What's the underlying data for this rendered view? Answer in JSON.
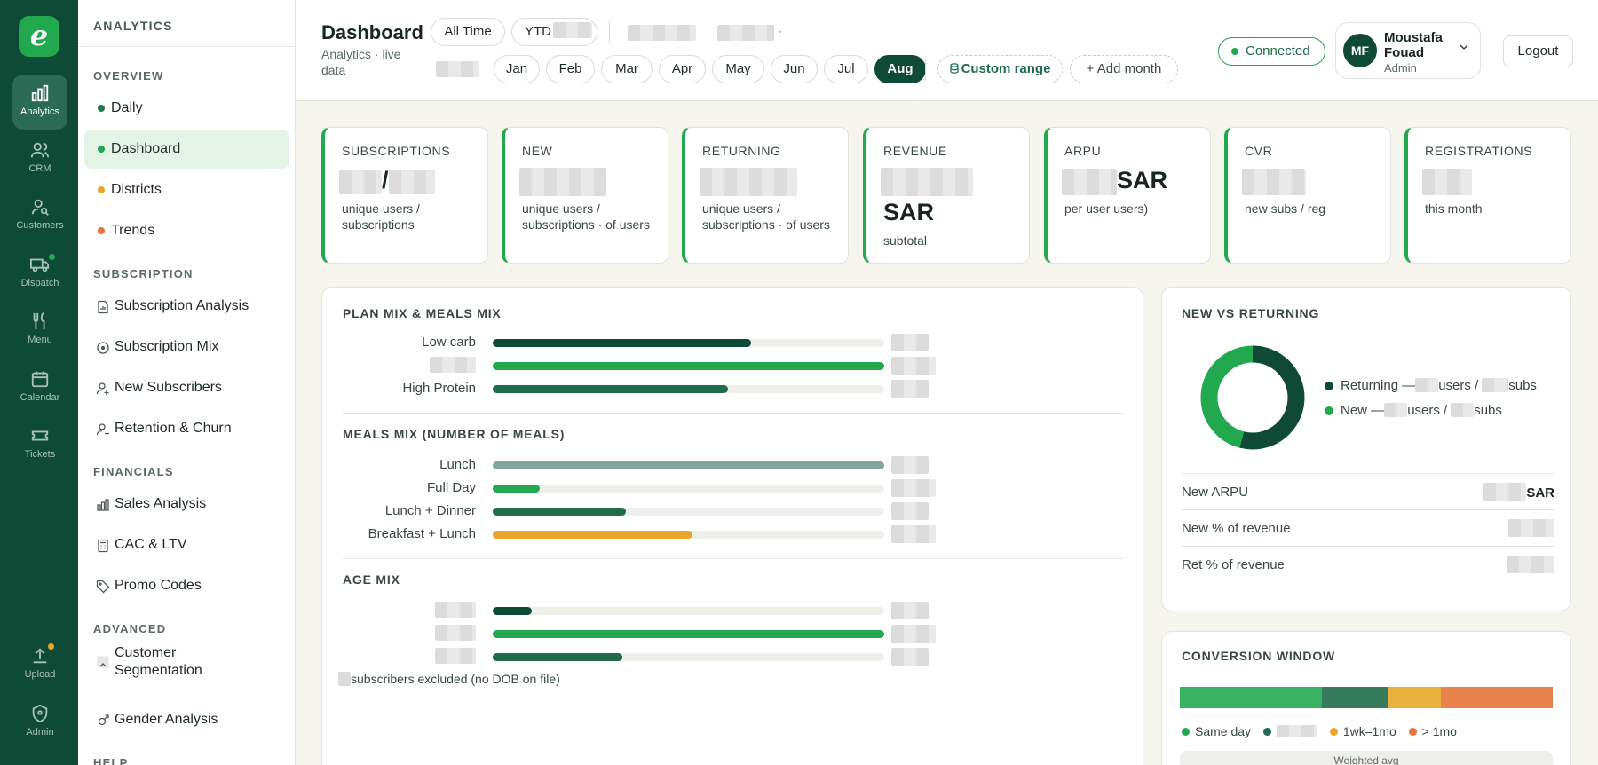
{
  "rail": {
    "logo": "e",
    "items": [
      {
        "label": "Analytics",
        "icon": "bar-chart-icon"
      },
      {
        "label": "CRM",
        "icon": "users-icon"
      },
      {
        "label": "Customers",
        "icon": "user-search-icon"
      },
      {
        "label": "Dispatch",
        "icon": "truck-icon"
      },
      {
        "label": "Menu",
        "icon": "utensils-icon"
      },
      {
        "label": "Calendar",
        "icon": "calendar-icon"
      },
      {
        "label": "Tickets",
        "icon": "ticket-icon"
      },
      {
        "label": "Upload",
        "icon": "upload-icon"
      },
      {
        "label": "Admin",
        "icon": "shield-icon"
      }
    ],
    "accent_dot": "#22a84f",
    "warning_dot": "#e8a72a"
  },
  "sidebar": {
    "app": "ANALYTICS",
    "sections": [
      {
        "title": "OVERVIEW",
        "items": [
          {
            "label": "Daily",
            "dot": "#1f7a4f"
          },
          {
            "label": "Dashboard",
            "dot": "#22a84f"
          },
          {
            "label": "Districts",
            "dot": "#e8a72a"
          },
          {
            "label": "Trends",
            "dot": "#e8743b"
          }
        ]
      },
      {
        "title": "SUBSCRIPTION",
        "items": [
          {
            "label": "Subscription Analysis",
            "icon": "document-chart-icon"
          },
          {
            "label": "Subscription Mix",
            "icon": "circle-dot-icon"
          },
          {
            "label": "New Subscribers",
            "icon": "user-plus-icon"
          },
          {
            "label": "Retention & Churn",
            "icon": "user-minus-icon"
          }
        ]
      },
      {
        "title": "FINANCIALS",
        "items": [
          {
            "label": "Sales Analysis",
            "icon": "bar-chart-icon"
          },
          {
            "label": "CAC & LTV",
            "icon": "calculator-icon"
          },
          {
            "label": "Promo Codes",
            "icon": "tag-icon"
          }
        ]
      },
      {
        "title": "ADVANCED",
        "items": [
          {
            "label": "Customer Segmentation",
            "icon": "segments-icon"
          },
          {
            "label": "Gender Analysis",
            "icon": "gender-icon"
          }
        ]
      },
      {
        "title": "HELP",
        "items": []
      }
    ]
  },
  "header": {
    "title": "Dashboard",
    "subtitle": "Analytics · live data",
    "ranges": [
      "All Time",
      "YTD"
    ],
    "months": [
      "Jan",
      "Feb",
      "Mar",
      "Apr",
      "May",
      "Jun",
      "Jul",
      "Aug"
    ],
    "active_month": "Aug",
    "custom_range": "Custom range",
    "add_month": "+ Add month",
    "connection": "Connected",
    "user": {
      "initials": "MF",
      "name": "Moustafa Fouad",
      "role": "Admin"
    },
    "logout": "Logout"
  },
  "kpis": [
    {
      "label": "SUBSCRIPTIONS",
      "value": "/",
      "desc": "unique users / subscriptions"
    },
    {
      "label": "NEW",
      "value": "",
      "desc": "unique users / subscriptions · of users"
    },
    {
      "label": "RETURNING",
      "value": "",
      "desc": "unique users / subscriptions · of users"
    },
    {
      "label": "REVENUE",
      "value": "SAR",
      "desc": "subtotal"
    },
    {
      "label": "ARPU",
      "value": "SAR",
      "desc": "per user  users)"
    },
    {
      "label": "CVR",
      "value": "",
      "desc": "new subs /  reg"
    },
    {
      "label": "REGISTRATIONS",
      "value": "",
      "desc": "this month"
    }
  ],
  "plan_mix": {
    "title": "PLAN MIX & MEALS MIX",
    "rows": [
      {
        "label": "Low carb",
        "fraction": 0.66,
        "color": "#0f4a36"
      },
      {
        "label": "",
        "fraction": 1.0,
        "color": "#22a84f"
      },
      {
        "label": "High Protein",
        "fraction": 0.6,
        "color": "#1f6b4a"
      }
    ]
  },
  "meals_mix": {
    "title": "MEALS MIX (NUMBER OF MEALS)",
    "rows": [
      {
        "label": "Lunch",
        "fraction": 1.0,
        "color": "#7fa89a"
      },
      {
        "label": "Full Day",
        "fraction": 0.12,
        "color": "#22a84f"
      },
      {
        "label": "Lunch + Dinner",
        "fraction": 0.34,
        "color": "#1f6b4a"
      },
      {
        "label": "Breakfast + Lunch",
        "fraction": 0.51,
        "color": "#e8a72a"
      }
    ]
  },
  "age_mix": {
    "title": "AGE MIX",
    "rows": [
      {
        "label": "",
        "fraction": 0.1,
        "color": "#0f4a36"
      },
      {
        "label": "",
        "fraction": 1.0,
        "color": "#22a84f"
      },
      {
        "label": "",
        "fraction": 0.33,
        "color": "#1f6b4a"
      }
    ],
    "footnote": "subscribers excluded (no DOB on file)"
  },
  "new_vs_returning": {
    "title": "NEW VS RETURNING",
    "donut": [
      {
        "name": "Returning",
        "fraction": 0.54,
        "color": "#0f4a36"
      },
      {
        "name": "New",
        "fraction": 0.46,
        "color": "#22a84f"
      }
    ],
    "legend": [
      {
        "prefix": "Returning —",
        "mid": "users /",
        "suffix": "subs",
        "color": "#0f4a36"
      },
      {
        "prefix": "New —",
        "mid": "users /",
        "suffix": "subs",
        "color": "#22a84f"
      }
    ],
    "stats": [
      {
        "label": "New ARPU",
        "value": "SAR"
      },
      {
        "label": "New % of revenue",
        "value": ""
      },
      {
        "label": "Ret % of revenue",
        "value": ""
      }
    ]
  },
  "conversion": {
    "title": "CONVERSION WINDOW",
    "segments": [
      {
        "fraction": 0.38,
        "color": "#22a84f"
      },
      {
        "fraction": 0.18,
        "color": "#1f6b4a"
      },
      {
        "fraction": 0.14,
        "color": "#e8a72a"
      },
      {
        "fraction": 0.3,
        "color": "#e8743b"
      }
    ],
    "legend": [
      "Same day",
      "",
      "1wk–1mo",
      "> 1mo"
    ],
    "footer": "Weighted avg"
  }
}
